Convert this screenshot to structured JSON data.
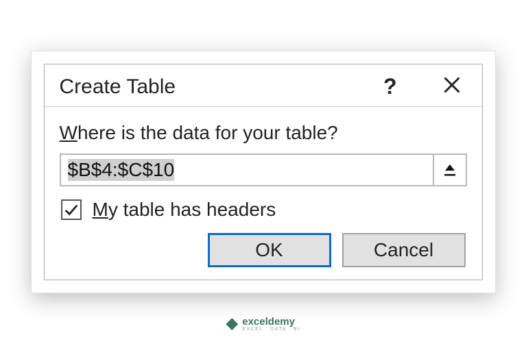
{
  "dialog": {
    "title": "Create Table",
    "prompt_prefix_underline": "W",
    "prompt_rest": "here is the data for your table?",
    "range_value": "$B$4:$C$10",
    "checkbox_checked": true,
    "checkbox_prefix_underline": "M",
    "checkbox_rest": "y table has headers",
    "ok_label": "OK",
    "cancel_label": "Cancel"
  },
  "watermark": {
    "name": "exceldemy",
    "sub": "EXCEL · DATA · BI"
  }
}
